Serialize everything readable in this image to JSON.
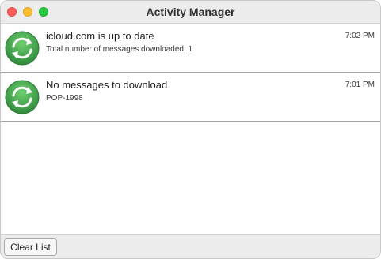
{
  "window": {
    "title": "Activity Manager"
  },
  "activities": [
    {
      "icon": "sync-icon",
      "title": "icloud.com is up to date",
      "subtitle": "Total number of messages downloaded: 1",
      "time": "7:02 PM"
    },
    {
      "icon": "sync-icon",
      "title": "No messages to download",
      "subtitle": "POP-1998",
      "time": "7:01 PM"
    }
  ],
  "footer": {
    "clear_label": "Clear List"
  },
  "colors": {
    "icon_green": "#3fa14a",
    "traffic_close": "#ff5f57",
    "traffic_minimize": "#febc2e",
    "traffic_zoom": "#28c840"
  }
}
